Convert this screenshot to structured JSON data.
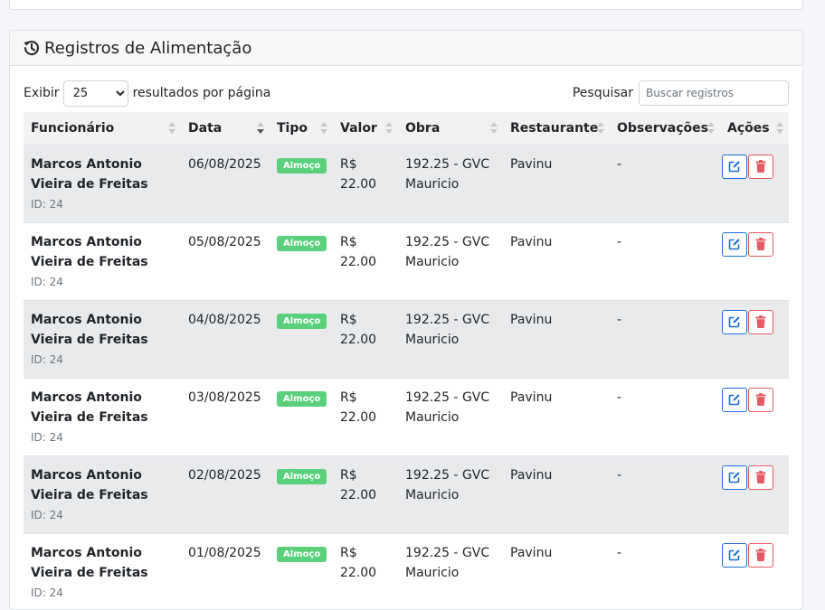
{
  "card": {
    "title": "Registros de Alimentação",
    "title_icon": "history-icon"
  },
  "length_menu": {
    "label_before": "Exibir",
    "selected": "25",
    "label_after": "resultados por página"
  },
  "search": {
    "label": "Pesquisar",
    "placeholder": "Buscar registros",
    "value": ""
  },
  "table": {
    "columns": [
      {
        "label": "Funcionário",
        "sort": "none"
      },
      {
        "label": "Data",
        "sort": "desc"
      },
      {
        "label": "Tipo",
        "sort": "none"
      },
      {
        "label": "Valor",
        "sort": "none"
      },
      {
        "label": "Obra",
        "sort": "none"
      },
      {
        "label": "Restaurante",
        "sort": "none"
      },
      {
        "label": "Observações",
        "sort": "none"
      },
      {
        "label": "Ações",
        "sort": "none"
      }
    ],
    "rows": [
      {
        "name": "Marcos Antonio Vieira de Freitas",
        "id": "ID: 24",
        "date": "06/08/2025",
        "type": "Almoço",
        "value": "R$ 22.00",
        "obra": "192.25 - GVC Mauricio",
        "restaurant": "Pavinu",
        "notes": "-"
      },
      {
        "name": "Marcos Antonio Vieira de Freitas",
        "id": "ID: 24",
        "date": "05/08/2025",
        "type": "Almoço",
        "value": "R$ 22.00",
        "obra": "192.25 - GVC Mauricio",
        "restaurant": "Pavinu",
        "notes": "-"
      },
      {
        "name": "Marcos Antonio Vieira de Freitas",
        "id": "ID: 24",
        "date": "04/08/2025",
        "type": "Almoço",
        "value": "R$ 22.00",
        "obra": "192.25 - GVC Mauricio",
        "restaurant": "Pavinu",
        "notes": "-"
      },
      {
        "name": "Marcos Antonio Vieira de Freitas",
        "id": "ID: 24",
        "date": "03/08/2025",
        "type": "Almoço",
        "value": "R$ 22.00",
        "obra": "192.25 - GVC Mauricio",
        "restaurant": "Pavinu",
        "notes": "-"
      },
      {
        "name": "Marcos Antonio Vieira de Freitas",
        "id": "ID: 24",
        "date": "02/08/2025",
        "type": "Almoço",
        "value": "R$ 22.00",
        "obra": "192.25 - GVC Mauricio",
        "restaurant": "Pavinu",
        "notes": "-"
      },
      {
        "name": "Marcos Antonio Vieira de Freitas",
        "id": "ID: 24",
        "date": "01/08/2025",
        "type": "Almoço",
        "value": "R$ 22.00",
        "obra": "192.25 - GVC Mauricio",
        "restaurant": "Pavinu",
        "notes": "-"
      }
    ]
  },
  "colors": {
    "badge": "#5bd07a",
    "edit": "#1b6ed8",
    "delete": "#e65a64",
    "stripe": "#e9eaec"
  }
}
